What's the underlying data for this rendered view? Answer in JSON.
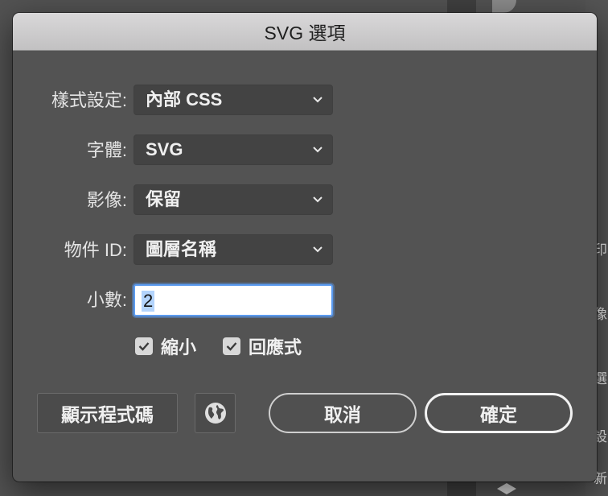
{
  "dialog": {
    "title": "SVG 選項"
  },
  "fields": {
    "styling": {
      "label": "樣式設定:",
      "value": "內部 CSS"
    },
    "font": {
      "label": "字體:",
      "value": "SVG"
    },
    "images": {
      "label": "影像:",
      "value": "保留"
    },
    "object_ids": {
      "label": "物件 ID:",
      "value": "圖層名稱"
    },
    "decimal": {
      "label": "小數:",
      "value": "2"
    }
  },
  "options": {
    "minify": {
      "label": "縮小",
      "checked": true
    },
    "responsive": {
      "label": "回應式",
      "checked": true
    }
  },
  "buttons": {
    "show_code": "顯示程式碼",
    "web_icon": "globe-icon",
    "cancel": "取消",
    "ok": "確定"
  },
  "background": {
    "side_labels": [
      "印",
      "像",
      "選",
      "設",
      "新"
    ]
  }
}
